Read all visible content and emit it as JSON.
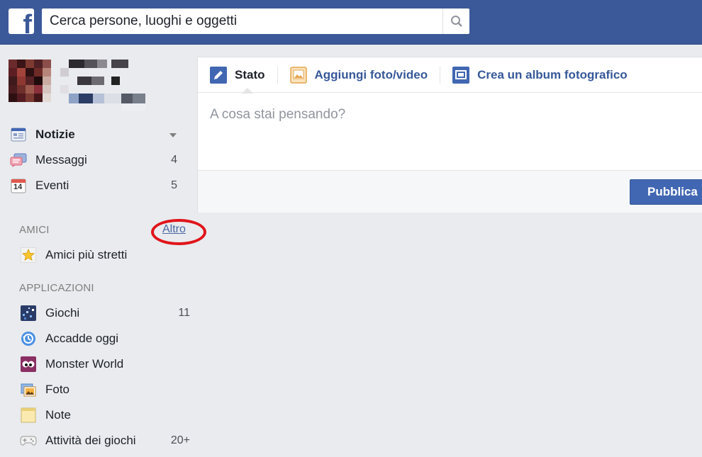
{
  "header": {
    "search_placeholder": "Cerca persone, luoghi e oggetti"
  },
  "nav": {
    "items": [
      {
        "label": "Notizie",
        "count": "",
        "icon": "news-feed-icon"
      },
      {
        "label": "Messaggi",
        "count": "4",
        "icon": "messages-icon"
      },
      {
        "label": "Eventi",
        "count": "5",
        "icon": "events-icon",
        "icon_text": "14"
      }
    ]
  },
  "friends": {
    "title": "AMICI",
    "more": "Altro",
    "items": [
      {
        "label": "Amici più stretti",
        "icon": "star-icon"
      }
    ]
  },
  "apps": {
    "title": "APPLICAZIONI",
    "items": [
      {
        "label": "Giochi",
        "count": "11",
        "icon": "games-icon"
      },
      {
        "label": "Accadde oggi",
        "count": "",
        "icon": "on-this-day-icon"
      },
      {
        "label": "Monster World",
        "count": "",
        "icon": "monster-world-icon"
      },
      {
        "label": "Foto",
        "count": "",
        "icon": "photos-icon"
      },
      {
        "label": "Note",
        "count": "",
        "icon": "notes-icon"
      },
      {
        "label": "Attività dei giochi",
        "count": "20+",
        "icon": "gamepad-icon"
      }
    ]
  },
  "composer": {
    "tabs": [
      {
        "label": "Stato",
        "icon": "pencil-icon"
      },
      {
        "label": "Aggiungi foto/video",
        "icon": "photo-icon"
      },
      {
        "label": "Crea un album fotografico",
        "icon": "album-icon"
      }
    ],
    "placeholder": "A cosa stai pensando?",
    "publish_label": "Pubblica"
  },
  "colors": {
    "brand": "#3b5998",
    "highlight_ring": "#e0151b"
  }
}
